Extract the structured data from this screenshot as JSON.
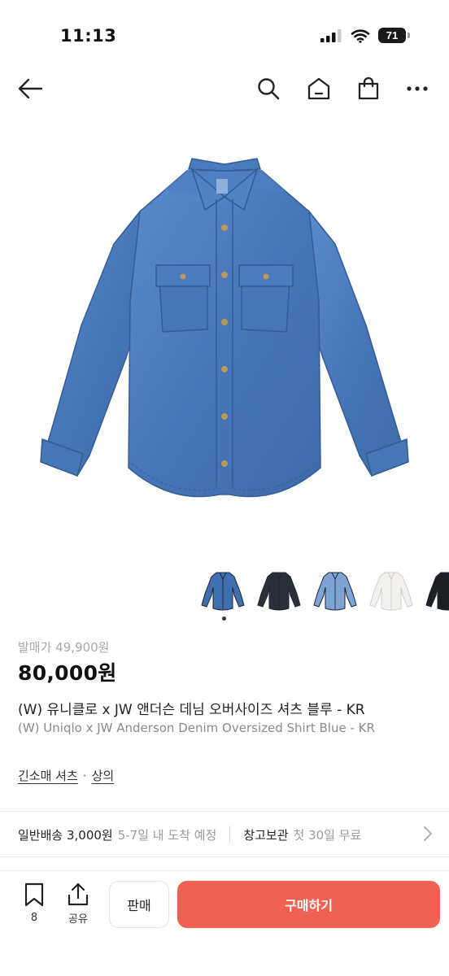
{
  "status_bar": {
    "time": "11:13",
    "battery": "71"
  },
  "nav": {
    "back_icon": "arrow-left-icon",
    "search_icon": "search-icon",
    "home_icon": "home-icon",
    "bag_icon": "shopping-bag-icon",
    "more_icon": "more-icon"
  },
  "gallery": {
    "thumbnails": [
      {
        "color": "#3f6fae"
      },
      {
        "color": "#2b2f38"
      },
      {
        "color": "#7ea4d4"
      },
      {
        "color": "#f2f1ee"
      },
      {
        "color": "#1e1f22"
      }
    ],
    "selected_index": 0
  },
  "product": {
    "original_price": "발매가 49,900원",
    "price": "80,000원",
    "title_ko": "(W) 유니클로 x JW 앤더슨 데님 오버사이즈 셔츠 블루 - KR",
    "title_en": "(W) Uniqlo x JW Anderson Denim Oversized Shirt Blue - KR",
    "categories": [
      "긴소매 셔츠",
      "상의"
    ],
    "category_separator": "·"
  },
  "shipping": {
    "standard_label": "일반배송 3,000원",
    "standard_eta": "5-7일 내 도착 예정",
    "storage_label": "창고보관",
    "storage_offer": "첫 30일 무료"
  },
  "bottom_bar": {
    "like_count": "8",
    "share_label": "공유",
    "sell_label": "판매",
    "buy_label": "구매하기"
  },
  "colors": {
    "accent": "#ef6253",
    "denim": "#4a7dbf"
  }
}
